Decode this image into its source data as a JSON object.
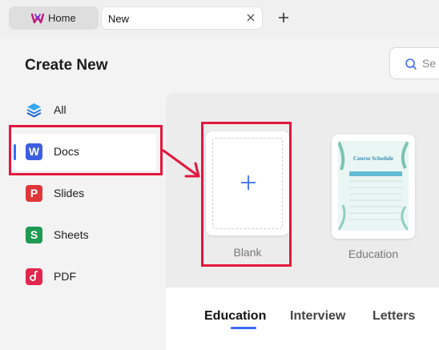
{
  "tabs": {
    "home_label": "Home",
    "new_label": "New"
  },
  "header": {
    "title": "Create New",
    "search_placeholder": "Se"
  },
  "sidebar": {
    "items": [
      {
        "label": "All",
        "icon": "layers-icon"
      },
      {
        "label": "Docs",
        "icon": "docs-icon",
        "letter": "W"
      },
      {
        "label": "Slides",
        "icon": "slides-icon",
        "letter": "P"
      },
      {
        "label": "Sheets",
        "icon": "sheets-icon",
        "letter": "S"
      },
      {
        "label": "PDF",
        "icon": "pdf-icon"
      }
    ]
  },
  "templates": {
    "blank_label": "Blank",
    "education_label": "Education",
    "education_card_title": "Course Schedule"
  },
  "categories": {
    "tabs": [
      "Education",
      "Interview",
      "Letters"
    ]
  },
  "colors": {
    "accent": "#3b6cf7",
    "annotation": "#e3173e",
    "docs": "#3c5ee0",
    "slides": "#e0363a",
    "sheets": "#1f9a54",
    "pdf": "#e2264d"
  }
}
